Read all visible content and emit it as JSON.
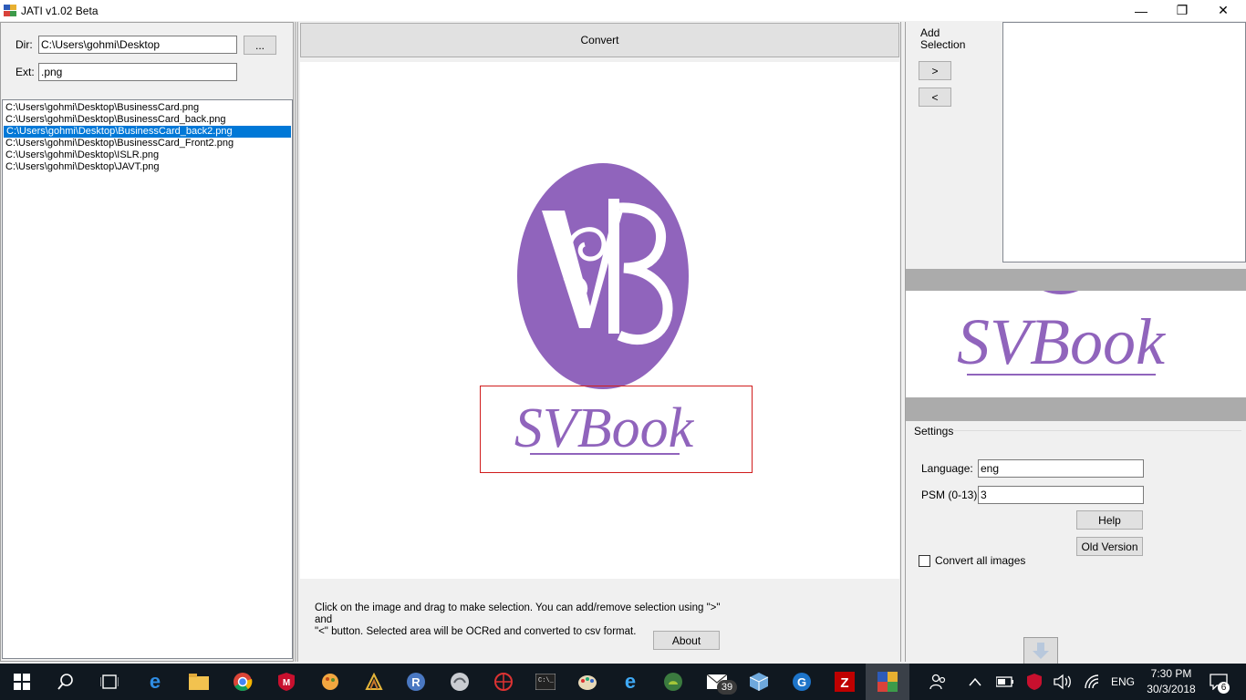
{
  "window": {
    "title": "JATI v1.02 Beta",
    "min_glyph": "—",
    "max_glyph": "❐",
    "close_glyph": "✕"
  },
  "left": {
    "dir_label": "Dir:",
    "dir_value": "C:\\Users\\gohmi\\Desktop",
    "browse_label": "...",
    "ext_label": "Ext:",
    "ext_value": ".png",
    "files": [
      "C:\\Users\\gohmi\\Desktop\\BusinessCard.png",
      "C:\\Users\\gohmi\\Desktop\\BusinessCard_back.png",
      "C:\\Users\\gohmi\\Desktop\\BusinessCard_back2.png",
      "C:\\Users\\gohmi\\Desktop\\BusinessCard_Front2.png",
      "C:\\Users\\gohmi\\Desktop\\ISLR.png",
      "C:\\Users\\gohmi\\Desktop\\JAVT.png"
    ],
    "selected_index": 2
  },
  "center": {
    "convert_label": "Convert",
    "hint_line1": "Click on the image and drag to make selection. You can add/remove selection using \">\" and",
    "hint_line2": "\"<\" button. Selected area will be OCRed and converted to csv format.",
    "about_label": "About",
    "logo_text": "SVBook",
    "brand_color": "#9064bc",
    "selection_color": "#d01c1c"
  },
  "right": {
    "add_selection_line1": "Add",
    "add_selection_line2": "Selection",
    "add_button": ">",
    "remove_button": "<",
    "preview_text": "SVBook",
    "settings_title": "Settings",
    "language_label": "Language:",
    "language_value": "eng",
    "psm_label": "PSM (0-13):",
    "psm_value": "3",
    "help_label": "Help",
    "old_version_label": "Old Version",
    "convert_all_label": "Convert all images",
    "convert_all_checked": false
  },
  "taskbar": {
    "icons": [
      "windows-start",
      "search",
      "task-view",
      "edge",
      "file-explorer",
      "chrome",
      "mcafee",
      "paint-app",
      "tiles-app",
      "r-app",
      "vpn-app",
      "spider-app",
      "terminal",
      "paint",
      "ie",
      "android-studio",
      "mail",
      "box-app",
      "g-app",
      "filezilla",
      "jati"
    ],
    "mail_badge": "39",
    "lang": "ENG",
    "time": "7:30 PM",
    "date": "30/3/2018",
    "notif_count": "6"
  }
}
